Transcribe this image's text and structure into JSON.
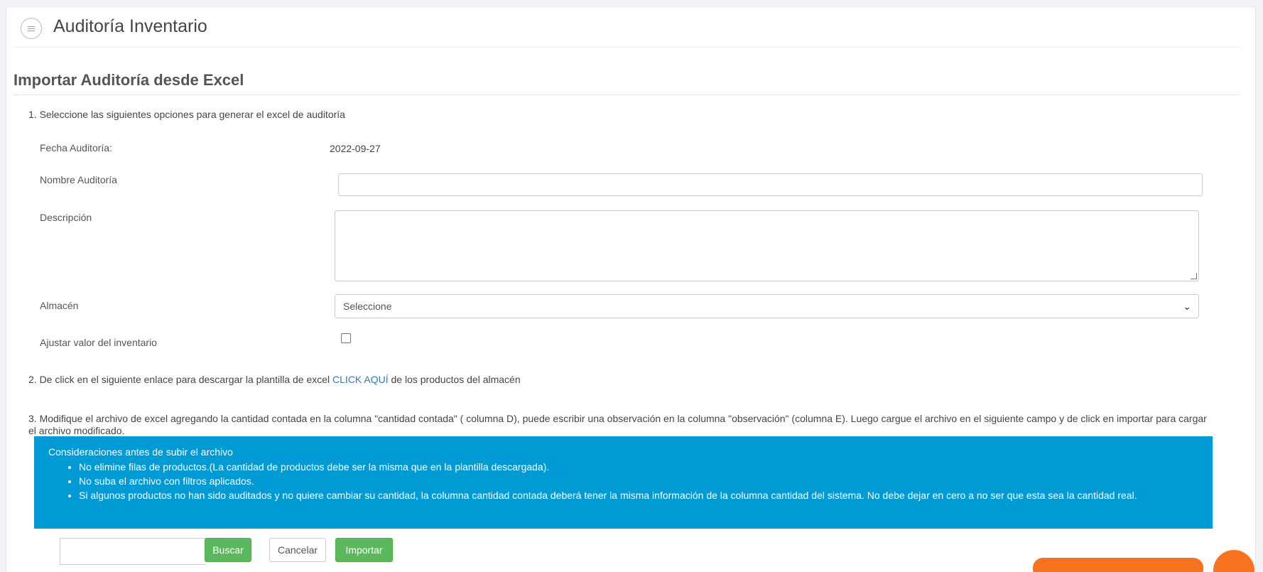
{
  "header": {
    "title": "Auditoría Inventario"
  },
  "section": {
    "title": "Importar Auditoría desde Excel"
  },
  "steps": {
    "step1": "1. Seleccione las siguientes opciones para generar el excel de auditoría",
    "step2_before": "2. De click en el siguiente enlace para descargar la plantilla de excel ",
    "step2_link": "CLICK AQUÍ",
    "step2_after": " de los productos del almacén",
    "step3": "3. Modifique el archivo de excel agregando la cantidad contada en la columna \"cantidad contada\" ( columna D), puede escribir una observación en la columna \"observación\" (columna E). Luego cargue el archivo en el siguiente campo y de click en importar para cargar el archivo modificado."
  },
  "form": {
    "fecha_label": "Fecha Auditoría:",
    "fecha_value": "2022-09-27",
    "nombre_label": "Nombre Auditoría",
    "nombre_value": "",
    "descripcion_label": "Descripción",
    "descripcion_value": "",
    "almacen_label": "Almacén",
    "almacen_selected": "Seleccione",
    "ajustar_label": "Ajustar valor del inventario",
    "ajustar_checked": false
  },
  "alert": {
    "title": "Consideraciones antes de subir el archivo",
    "items": [
      "No elimine filas de productos.(La cantidad de productos debe ser la misma que en la plantilla descargada).",
      "No suba el archivo con filtros aplicados.",
      "Si algunos productos no han sido auditados y no quiere cambiar su cantidad, la columna cantidad contada deberá tener la misma información de la columna cantidad del sistema. No debe dejar en cero a no ser que esta sea la cantidad real."
    ]
  },
  "actions": {
    "file_value": "",
    "buscar_label": "Buscar",
    "cancelar_label": "Cancelar",
    "importar_label": "Importar"
  },
  "colors": {
    "accent_link": "#337ab7",
    "alert_bg": "#009bd5",
    "success": "#5cb85c",
    "floating": "#f7731f"
  },
  "icons": {
    "menu": "menu-lines-icon",
    "select": "chevron-down-icon",
    "resize": "resize-grip-icon"
  }
}
